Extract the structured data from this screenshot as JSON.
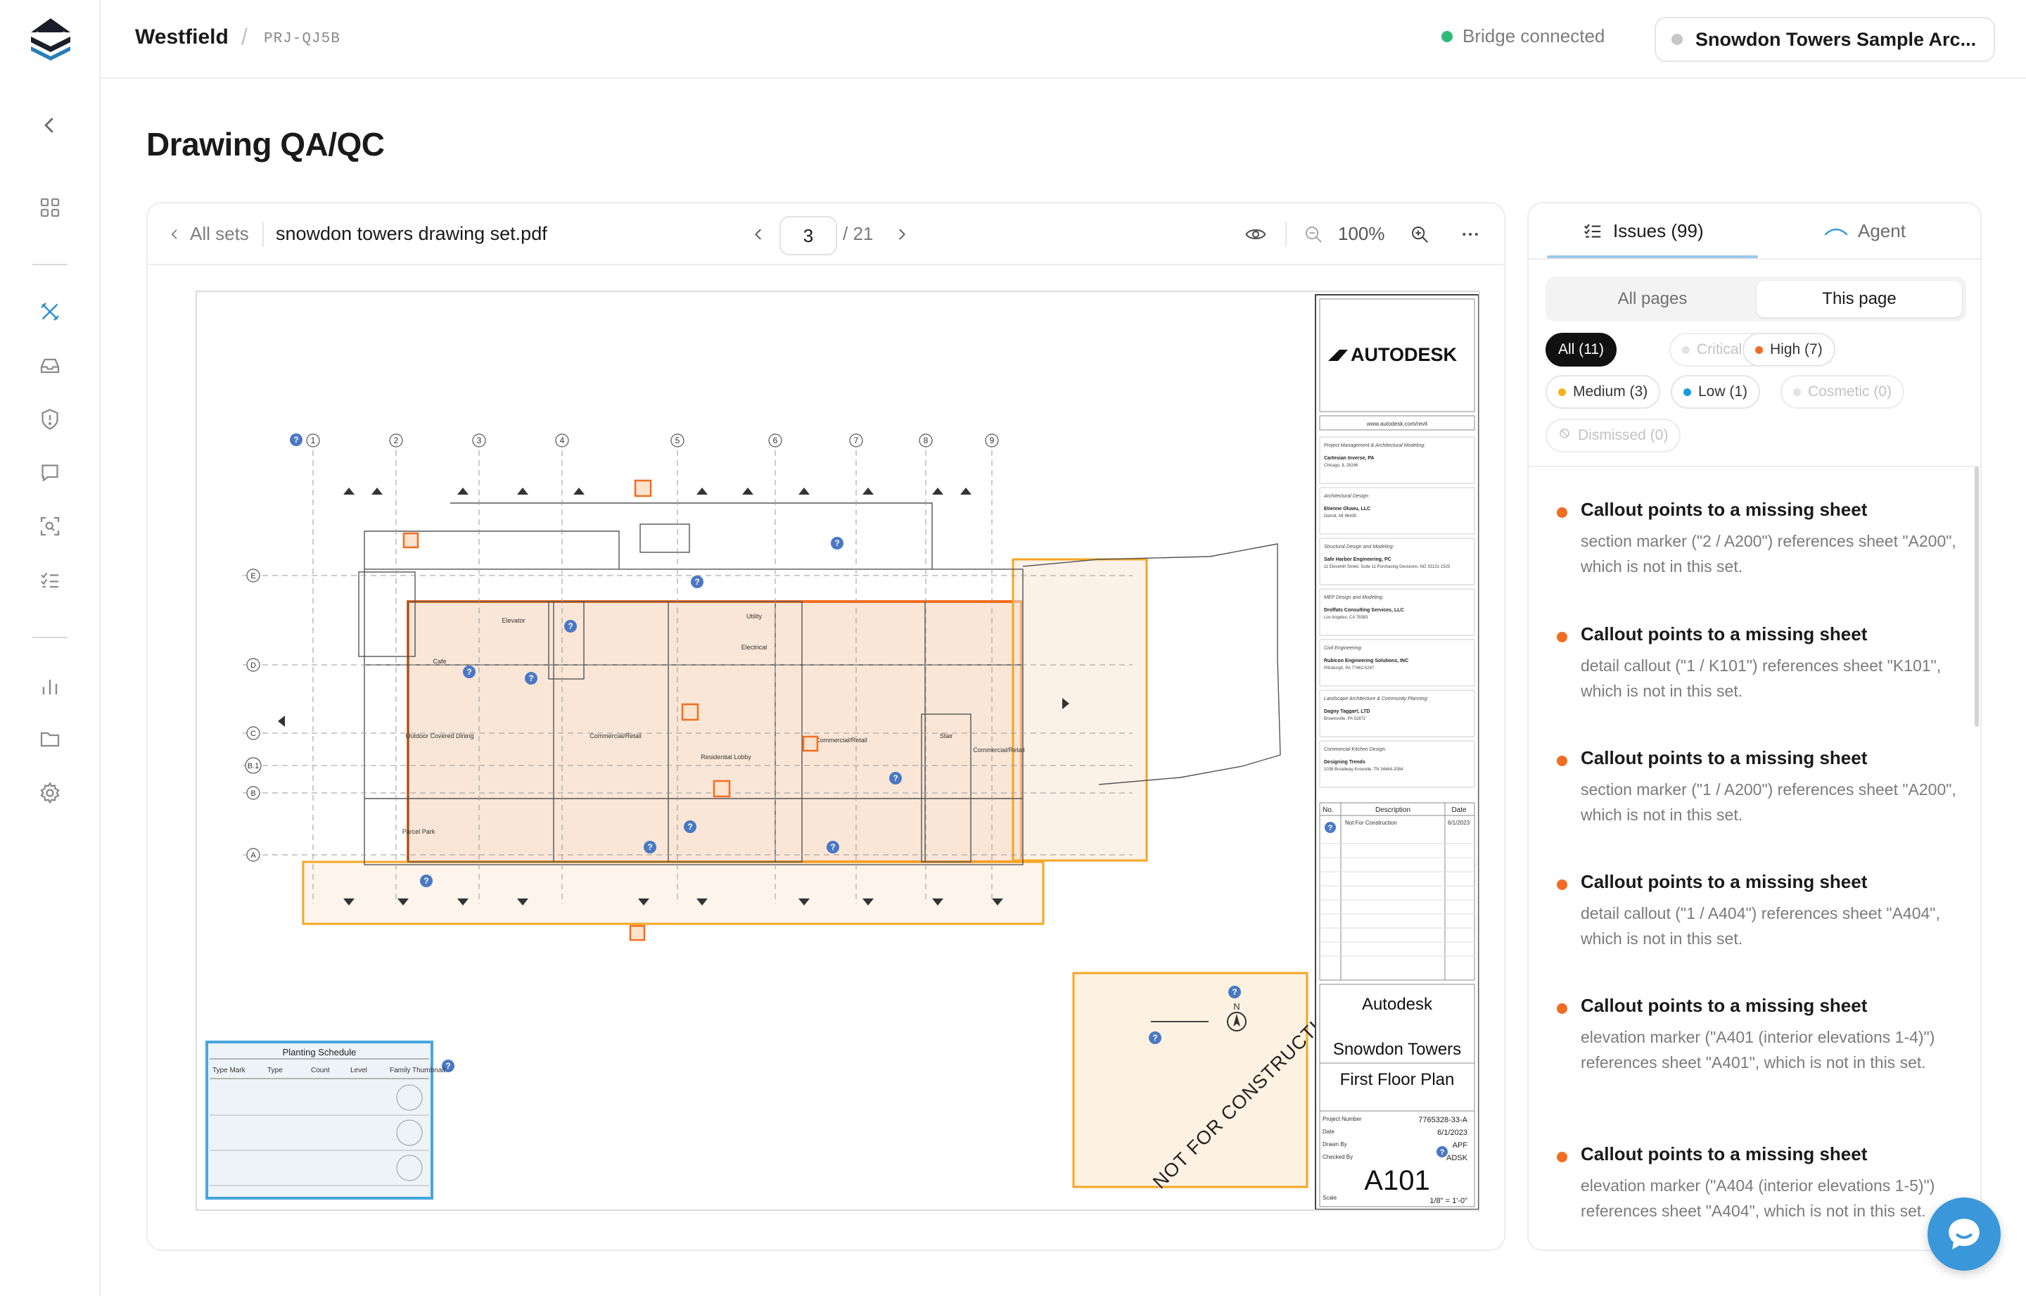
{
  "nav": {
    "logo": "stacked-layers-logo",
    "items": [
      "collapse-chevron",
      "dashboard-grid",
      "drawing-qaqc",
      "inbox",
      "shield-alert",
      "messages",
      "scan-search",
      "checklist",
      "analytics",
      "folder",
      "settings"
    ]
  },
  "topbar": {
    "workspace": "Westfield",
    "separator": "/",
    "project_code": "PRJ-QJ5B",
    "bridge_status": "Bridge connected",
    "project_selector": "Snowdon Towers Sample Arc..."
  },
  "page": {
    "title": "Drawing QA/QC"
  },
  "viewer": {
    "back_label": "All sets",
    "file_name": "snowdon towers drawing set.pdf",
    "page_current": "3",
    "page_total": "/ 21",
    "zoom": "100%"
  },
  "sheet": {
    "brand": "AUTODESK",
    "website": "www.autodesk.com/revit",
    "consultants": [
      {
        "role": "Project Management & Architectural Modeling:",
        "name": "Cartesian Inverse, PA",
        "addr": "Chicago, IL 28246"
      },
      {
        "role": "Architectural Design:",
        "name": "Etienne Oluwu, LLC",
        "addr": "Detroit, MI 96435"
      },
      {
        "role": "Structural Design and Modeling:",
        "name": "Safe Harbor Engineering, PC",
        "addr": "11 Eleventh Street, Suite 11\nPurchasing Decisions, NO 33131-1525"
      },
      {
        "role": "MEP Design and Modeling:",
        "name": "Droffats Consulting Services, LLC",
        "addr": "Los Angeles, CA 78383"
      },
      {
        "role": "Civil Engineering:",
        "name": "Rubicon Engineering Solutions, INC",
        "addr": "Pittsburgh, PA 77462-5247"
      },
      {
        "role": "Landscape Architecture & Community Planning:",
        "name": "Dagny Taggart, LTD",
        "addr": "Brownsville, PA 52872"
      },
      {
        "role": "Commercial Kitchen Design:",
        "name": "Designing Trends",
        "addr": "1038 Broadway\nKnoxville, TN 34664-2084"
      }
    ],
    "revision_headers": [
      "No.",
      "Description",
      "Date"
    ],
    "revision_row": {
      "desc": "Not For Construction",
      "date": "6/1/2023"
    },
    "company": "Autodesk",
    "project_name": "Snowdon Towers",
    "sheet_title": "First Floor Plan",
    "project_number_label": "Project Number",
    "project_number": "7765328-33-A",
    "date_label": "Date",
    "date": "6/1/2023",
    "drawn_by_label": "Drawn By",
    "drawn_by": "APF",
    "checked_by_label": "Checked By",
    "checked_by": "ADSK",
    "sheet_number": "A101",
    "scale_label": "Scale",
    "scale": "1/8\" = 1'-0\"",
    "stamp": "NOT FOR CONSTRUCTION",
    "schedule_title": "Planting Schedule",
    "schedule_headers": [
      "Type Mark",
      "Type",
      "Count",
      "Level",
      "Family Thumbnail"
    ],
    "room_labels": [
      "Cafe",
      "Outdoor Covered Dining",
      "Commercial/Retail",
      "Residential Lobby",
      "Commercial/Retail",
      "Commercial/Retail",
      "Elevator",
      "Stair",
      "Utility",
      "Electrical",
      "Parcel Park"
    ],
    "grid_numbers": [
      "1",
      "2",
      "3",
      "4",
      "5",
      "6",
      "7",
      "8",
      "9"
    ],
    "grid_letters": [
      "E",
      "D",
      "C",
      "B.1",
      "B",
      "A"
    ]
  },
  "panel": {
    "tab_issues": "Issues (99)",
    "tab_agent": "Agent",
    "seg_all": "All pages",
    "seg_this": "This page",
    "filters": [
      {
        "label": "All (11)",
        "state": "selected",
        "color": ""
      },
      {
        "label": "Critical (0)",
        "state": "dim",
        "color": "#e3e3e3"
      },
      {
        "label": "High (7)",
        "state": "normal",
        "color": "#f26d21"
      },
      {
        "label": "Medium (3)",
        "state": "normal",
        "color": "#f2b21e"
      },
      {
        "label": "Low (1)",
        "state": "normal",
        "color": "#1b9be0"
      },
      {
        "label": "Cosmetic (0)",
        "state": "dim",
        "color": "#e3e3e3"
      },
      {
        "label": "Dismissed (0)",
        "state": "dim",
        "color": ""
      }
    ],
    "issues": [
      {
        "title": "Callout points to a missing sheet",
        "body": "section marker (\"2 / A200\") references sheet \"A200\", which is not in this set."
      },
      {
        "title": "Callout points to a missing sheet",
        "body": "detail callout (\"1 / K101\") references sheet \"K101\", which is not in this set."
      },
      {
        "title": "Callout points to a missing sheet",
        "body": "section marker (\"1 / A200\") references sheet \"A200\", which is not in this set."
      },
      {
        "title": "Callout points to a missing sheet",
        "body": "detail callout (\"1 / A404\") references sheet \"A404\", which is not in this set."
      },
      {
        "title": "Callout points to a missing sheet",
        "body": "elevation marker (\"A401 (interior elevations 1-4)\") references sheet \"A401\", which is not in this set."
      },
      {
        "title": "Callout points to a missing sheet",
        "body": "elevation marker (\"A404 (interior elevations 1-5)\") references sheet \"A404\", which is not in this set."
      }
    ]
  },
  "colors": {
    "accent_orange": "#f26d21",
    "highlight_orange": "#f5a623",
    "schedule_blue": "#45a7de",
    "marker_blue": "#4a78c4",
    "connected_green": "#2fb978"
  }
}
